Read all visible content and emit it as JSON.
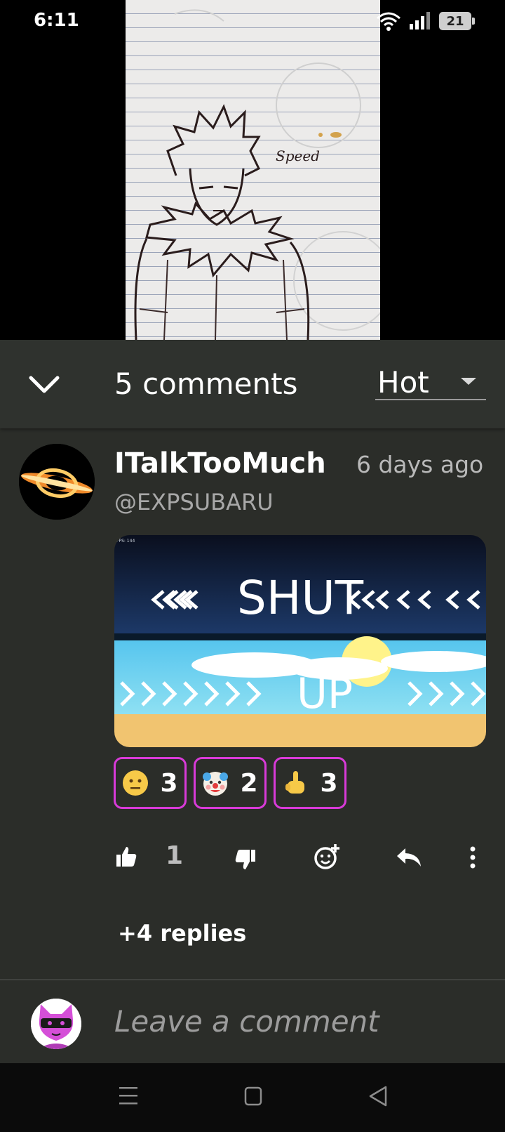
{
  "status_bar": {
    "time": "6:11",
    "battery": "21"
  },
  "media": {
    "caption": "Speed"
  },
  "comments": {
    "count_label": "5 comments",
    "sort": {
      "selected": "Hot"
    }
  },
  "comment": {
    "username": "ITalkTooMuch",
    "timestamp": "6 days ago",
    "handle": "@EXPSUBARU",
    "gif": {
      "top_text": "SHUT",
      "bottom_text": "UP",
      "corner_label": "FPS: 144"
    },
    "reactions": [
      {
        "emoji": "neutral-face",
        "count": "3"
      },
      {
        "emoji": "clown-face",
        "count": "2"
      },
      {
        "emoji": "middle-finger",
        "count": "3"
      }
    ],
    "likes": "1",
    "replies_label": "+4 replies"
  },
  "composer": {
    "placeholder": "Leave a comment"
  },
  "colors": {
    "panel": "#2b2d29",
    "reaction_border": "#d83ad8"
  }
}
